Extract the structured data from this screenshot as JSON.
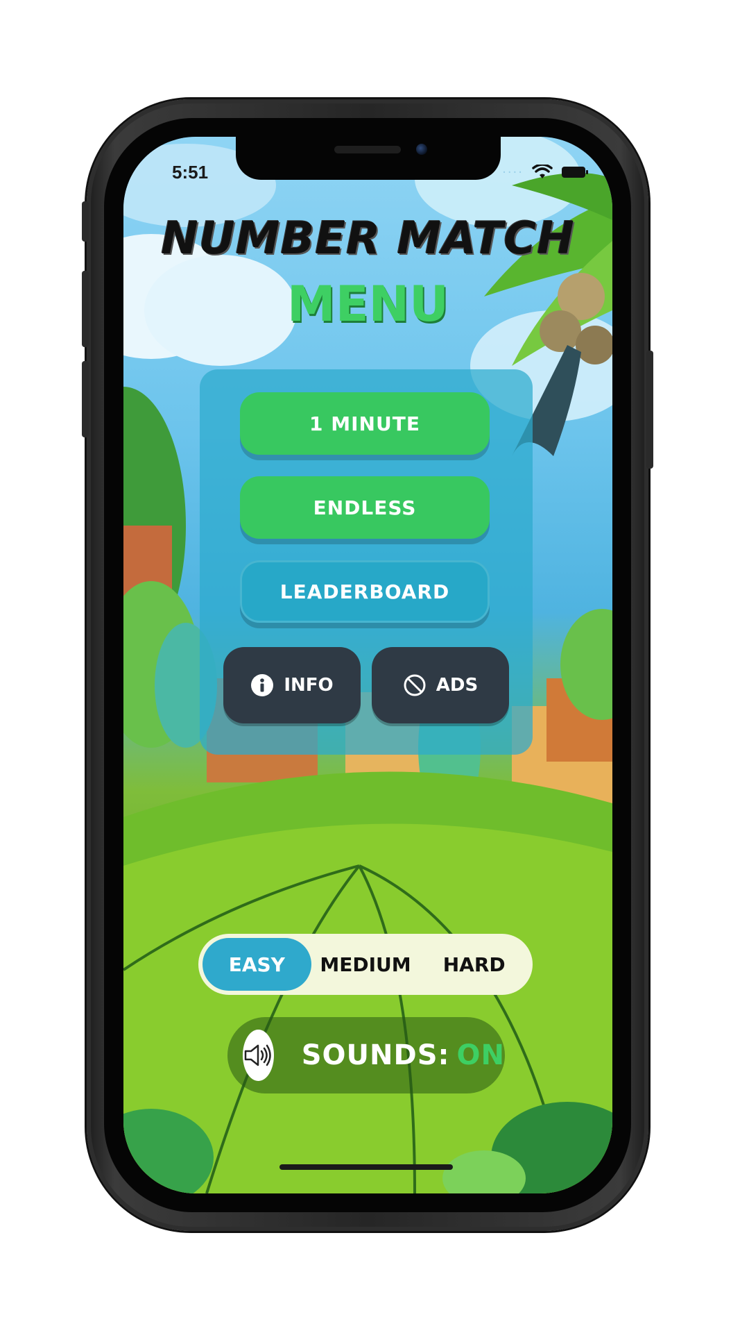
{
  "status_bar": {
    "time": "5:51",
    "icons": [
      "wifi-icon",
      "battery-icon"
    ]
  },
  "header": {
    "game_title": "NUMBER MATCH",
    "menu_title": "MENU"
  },
  "menu": {
    "buttons": [
      {
        "label": "1 MINUTE"
      },
      {
        "label": "ENDLESS"
      },
      {
        "label": "LEADERBOARD"
      }
    ],
    "info_label": "INFO",
    "ads_label": "ADS"
  },
  "difficulty": {
    "options": [
      {
        "label": "EASY"
      },
      {
        "label": "MEDIUM"
      },
      {
        "label": "HARD"
      }
    ],
    "selected": "EASY"
  },
  "sounds": {
    "label": "SOUNDS:",
    "state": "ON"
  },
  "colors": {
    "primary_green": "#38c860",
    "accent_blue": "#27a8c8",
    "dark_button": "#2f3a45",
    "sound_on": "#3ecf63"
  }
}
